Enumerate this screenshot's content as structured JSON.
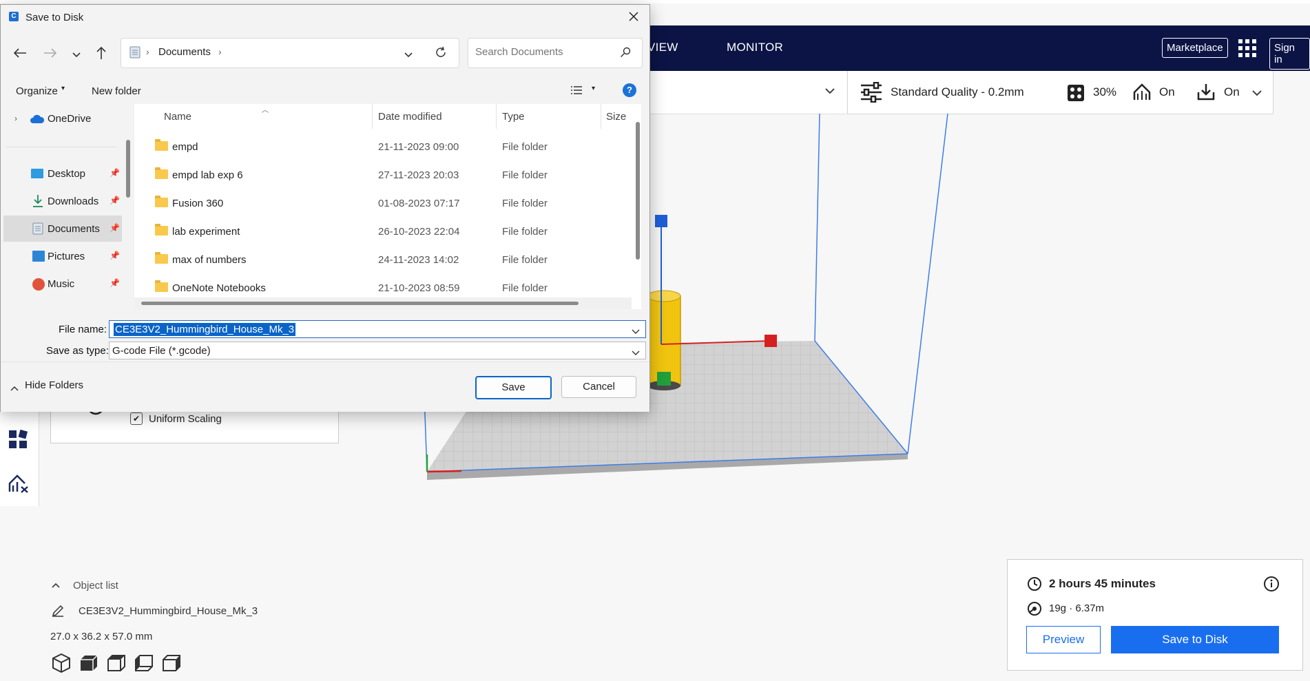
{
  "cura": {
    "header": {
      "tab_prepare_partial": "VIEW",
      "tab_monitor": "MONITOR",
      "marketplace": "Marketplace",
      "sign_in": "Sign in"
    },
    "print_setup": {
      "profile": "Standard Quality - 0.2mm",
      "infill": "30%",
      "support": "On",
      "adhesion": "On"
    },
    "scale_panel": {
      "uniform_scaling_label": "Uniform Scaling",
      "uniform_scaling_checked": true
    },
    "object_list": {
      "title": "Object list",
      "object_name": "CE3E3V2_Hummingbird_House_Mk_3",
      "dimensions": "27.0 x 36.2 x 57.0 mm"
    },
    "estimate": {
      "time": "2 hours 45 minutes",
      "material": "19g · 6.37m",
      "preview_label": "Preview",
      "save_label": "Save to Disk"
    },
    "colors": {
      "header_bg": "#0b1445",
      "accent_blue": "#196ef0"
    }
  },
  "dialog": {
    "title": "Save to Disk",
    "address": {
      "location": "Documents"
    },
    "search": {
      "placeholder": "Search Documents"
    },
    "commands": {
      "organize": "Organize",
      "new_folder": "New folder"
    },
    "nav": [
      {
        "label": "OneDrive",
        "icon": "cloud-icon",
        "pinned": false
      },
      {
        "label": "Desktop",
        "icon": "desktop-icon",
        "pinned": true
      },
      {
        "label": "Downloads",
        "icon": "download-icon",
        "pinned": true
      },
      {
        "label": "Documents",
        "icon": "documents-icon",
        "pinned": true,
        "selected": true
      },
      {
        "label": "Pictures",
        "icon": "pictures-icon",
        "pinned": true
      },
      {
        "label": "Music",
        "icon": "music-icon",
        "pinned": true
      }
    ],
    "columns": {
      "name": "Name",
      "date": "Date modified",
      "type": "Type",
      "size": "Size"
    },
    "files": [
      {
        "name": "empd",
        "date": "21-11-2023 09:00",
        "type": "File folder"
      },
      {
        "name": "empd lab exp 6",
        "date": "27-11-2023 20:03",
        "type": "File folder"
      },
      {
        "name": "Fusion 360",
        "date": "01-08-2023 07:17",
        "type": "File folder"
      },
      {
        "name": "lab experiment",
        "date": "26-10-2023 22:04",
        "type": "File folder"
      },
      {
        "name": "max of numbers",
        "date": "24-11-2023 14:02",
        "type": "File folder"
      },
      {
        "name": "OneNote Notebooks",
        "date": "21-10-2023 08:59",
        "type": "File folder"
      }
    ],
    "file_name_label": "File name:",
    "file_name_value": "CE3E3V2_Hummingbird_House_Mk_3",
    "save_as_type_label": "Save as type:",
    "save_as_type_value": "G-code File (*.gcode)",
    "hide_folders": "Hide Folders",
    "save_button": "Save",
    "cancel_button": "Cancel"
  }
}
